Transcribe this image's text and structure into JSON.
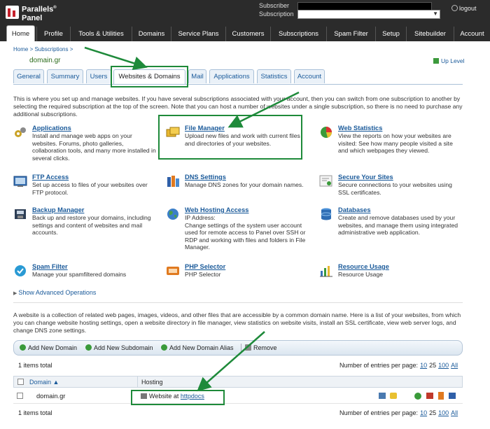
{
  "brand": {
    "line1": "Parallels",
    "line2": "Panel",
    "mark": "®"
  },
  "topbar": {
    "subscriber_label": "Subscriber",
    "subscription_label": "Subscription",
    "logout": "logout"
  },
  "nav": [
    "Home",
    "Profile",
    "Tools & Utilities",
    "Domains",
    "Service Plans",
    "Customers",
    "Subscriptions",
    "Spam Filter",
    "Setup",
    "Sitebuilder",
    "Account"
  ],
  "breadcrumb": "Home > Subscriptions >",
  "domain_title": "domain.gr",
  "up_level": "Up Level",
  "tabs": [
    "General",
    "Summary",
    "Users",
    "Websites & Domains",
    "Mail",
    "Applications",
    "Statistics",
    "Account"
  ],
  "intro": "This is where you set up and manage websites. If you have several subscriptions associated with your account, then you can switch from one subscription to another by selecting the required subscription at the top of the screen. Note that you can host a number of websites under a single subscription, so there is no need to purchase any additional subscriptions.",
  "tools": [
    {
      "name": "Applications",
      "desc": "Install and manage web apps on your websites. Forums, photo galleries, collaboration tools, and many more installed in several clicks.",
      "icon": "applications-icon"
    },
    {
      "name": "File Manager",
      "desc": "Upload new files and work with current files and directories of your websites.",
      "icon": "folder-icon"
    },
    {
      "name": "Web Statistics",
      "desc": "View the reports on how your websites are visited: See how many people visited a site and which webpages they viewed.",
      "icon": "pie-chart-icon"
    },
    {
      "name": "FTP Access",
      "desc": "Set up access to files of your websites over FTP protocol.",
      "icon": "ftp-icon"
    },
    {
      "name": "DNS Settings",
      "desc": "Manage DNS zones for your domain names.",
      "icon": "dns-icon"
    },
    {
      "name": "Secure Your Sites",
      "desc": "Secure connections to your websites using SSL certificates.",
      "icon": "certificate-icon"
    },
    {
      "name": "Backup Manager",
      "desc": "Back up and restore your domains, including settings and content of websites and mail accounts.",
      "icon": "backup-icon"
    },
    {
      "name": "Web Hosting Access",
      "desc": "IP Address:\nChange settings of the system user account used for remote access to Panel over SSH or RDP and working with files and folders in File Manager.",
      "icon": "globe-icon"
    },
    {
      "name": "Databases",
      "desc": "Create and remove databases used by your websites, and manage them using integrated administrative web application.",
      "icon": "database-icon"
    },
    {
      "name": "Spam Filter",
      "desc": "Manage your spamfiltered domains",
      "icon": "spam-filter-icon"
    },
    {
      "name": "PHP Selector",
      "desc": "PHP Selector",
      "icon": "php-icon"
    },
    {
      "name": "Resource Usage",
      "desc": "Resource Usage",
      "icon": "bar-chart-icon"
    }
  ],
  "show_advanced": "Show Advanced Operations",
  "about_websites": "A website is a collection of related web pages, images, videos, and other files that are accessible by a common domain name. Here is a list of your websites, from which you can change website hosting settings, open a website directory in file manager, view statistics on website visits, install an SSL certificate, view web server logs, and change DNS zone settings.",
  "toolbar": {
    "add_domain": "Add New Domain",
    "add_subdomain": "Add New Subdomain",
    "add_alias": "Add New Domain Alias",
    "remove": "Remove"
  },
  "list": {
    "total": "1 items total",
    "per_page_label": "Number of entries per page:",
    "per_page_options": [
      "10",
      "25",
      "100",
      "All"
    ],
    "per_page_current": "25",
    "columns": {
      "domain": "Domain",
      "hosting": "Hosting"
    },
    "rows": [
      {
        "domain": "domain.gr",
        "hosting_prefix": "Website at",
        "hosting_link": "httpdocs"
      }
    ]
  },
  "colors": {
    "topbar": "#2b2b2b",
    "link": "#1a5a9a",
    "highlight": "#1e8a3a"
  }
}
